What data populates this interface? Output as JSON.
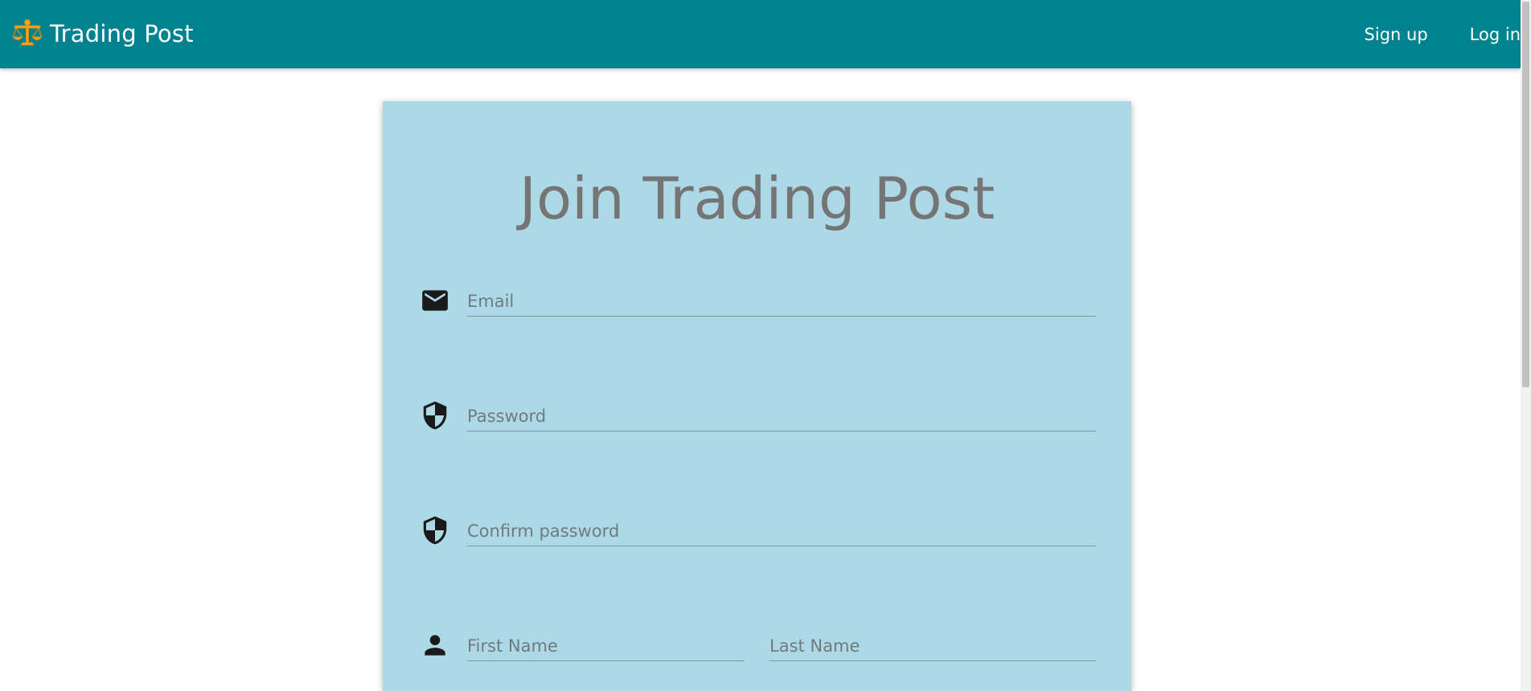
{
  "colors": {
    "brand": "#00838f",
    "card": "#add8e6",
    "logo": "#f5a623"
  },
  "header": {
    "brand_icon": "scales-icon",
    "brand_name": "Trading Post",
    "nav": [
      {
        "label": "Sign up"
      },
      {
        "label": "Log in"
      }
    ]
  },
  "form": {
    "title": "Join Trading Post",
    "email": {
      "icon": "mail-icon",
      "placeholder": "Email",
      "value": ""
    },
    "password": {
      "icon": "shield-icon",
      "placeholder": "Password",
      "value": ""
    },
    "confirm_password": {
      "icon": "shield-icon",
      "placeholder": "Confirm password",
      "value": ""
    },
    "name": {
      "icon": "person-icon",
      "first_placeholder": "First Name",
      "last_placeholder": "Last Name"
    }
  }
}
